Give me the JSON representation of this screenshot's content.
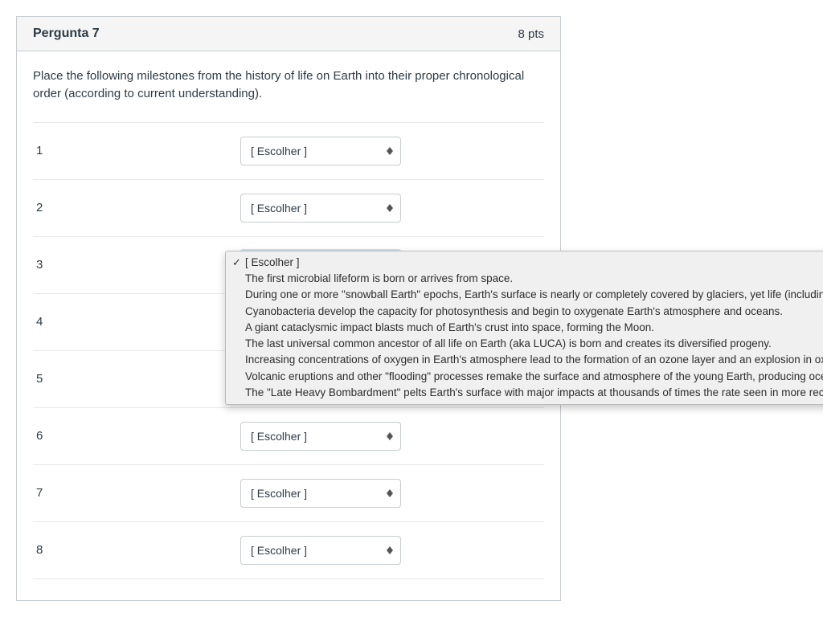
{
  "header": {
    "title": "Pergunta 7",
    "points": "8 pts"
  },
  "question": {
    "text": "Place the following milestones from the history of life on Earth into their proper chronological order (according to current understanding)."
  },
  "select_placeholder": "[ Escolher ]",
  "rows": [
    {
      "label": "1"
    },
    {
      "label": "2"
    },
    {
      "label": "3"
    },
    {
      "label": "4"
    },
    {
      "label": "5"
    },
    {
      "label": "6"
    },
    {
      "label": "7"
    },
    {
      "label": "8"
    }
  ],
  "dropdown": {
    "options": [
      {
        "checked": true,
        "text": "[ Escolher ]"
      },
      {
        "checked": false,
        "text": "The first microbial lifeform is born or arrives from space."
      },
      {
        "checked": false,
        "text": "During one or more \"snowball Earth\" epochs, Earth's surface is nearly or completely covered by glaciers, yet life (including"
      },
      {
        "checked": false,
        "text": "Cyanobacteria develop the capacity for photosynthesis and begin to oxygenate Earth's atmosphere and oceans."
      },
      {
        "checked": false,
        "text": "A giant cataclysmic impact blasts much of Earth's crust into space, forming the Moon."
      },
      {
        "checked": false,
        "text": "The last universal common ancestor of all life on Earth (aka LUCA) is born and creates its diversified progeny."
      },
      {
        "checked": false,
        "text": "Increasing concentrations of oxygen in Earth's atmosphere lead to the formation of an ozone layer and an explosion in oxygen-"
      },
      {
        "checked": false,
        "text": "Volcanic eruptions and other \"flooding\" processes remake the surface and atmosphere of the young Earth, producing oceans of"
      },
      {
        "checked": false,
        "text": "The \"Late Heavy Bombardment\" pelts Earth's surface with major impacts at thousands of times the rate seen in more recent"
      }
    ]
  }
}
